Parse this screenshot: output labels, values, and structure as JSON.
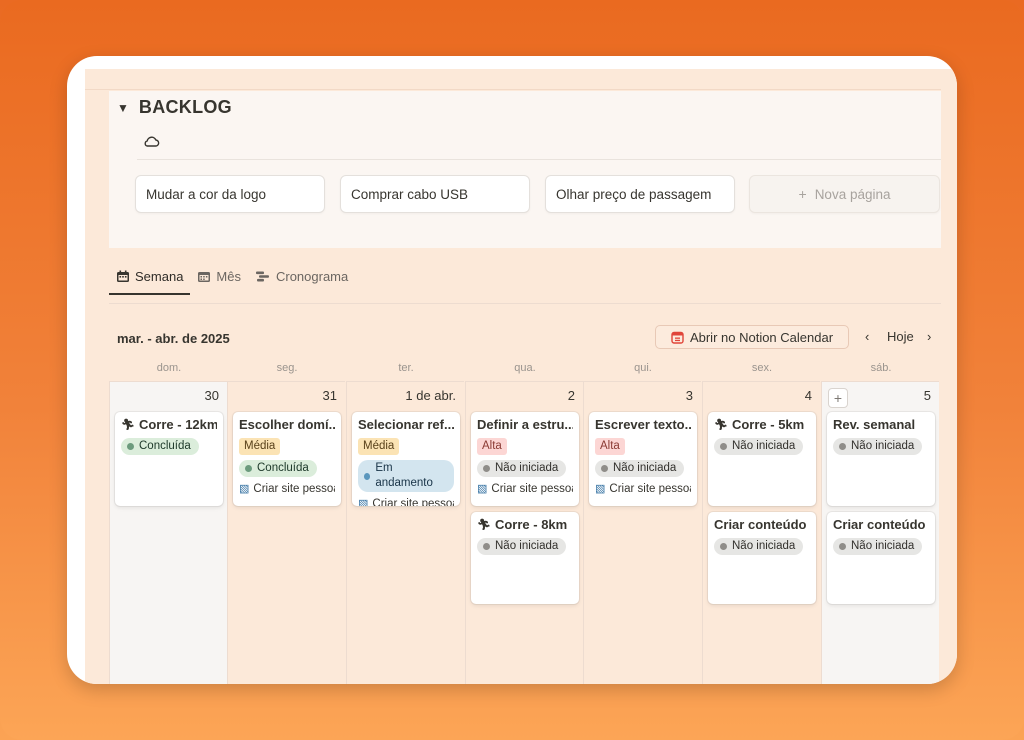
{
  "backlog": {
    "title": "BACKLOG",
    "cards": [
      "Mudar a cor da logo",
      "Comprar cabo USB",
      "Olhar preço de passagem"
    ],
    "new_page": "Nova página"
  },
  "tabs": [
    "Semana",
    "Mês",
    "Cronograma"
  ],
  "calendar": {
    "range": "mar. - abr. de 2025",
    "open_notion": "Abrir no Notion Calendar",
    "today": "Hoje",
    "days": [
      "dom.",
      "seg.",
      "ter.",
      "qua.",
      "qui.",
      "sex.",
      "sáb."
    ],
    "dates": [
      "30",
      "31",
      "1 de abr.",
      "2",
      "3",
      "4",
      "5"
    ]
  },
  "events": {
    "sun": {
      "title": "Corre - 12km",
      "status": "Concluída"
    },
    "mon": {
      "title": "Escolher domí...",
      "priority": "Média",
      "status": "Concluída",
      "relation": "Criar site pessoal"
    },
    "tue": {
      "title": "Selecionar ref...",
      "priority": "Média",
      "status": "Em andamento",
      "relation": "Criar site pessoal"
    },
    "wed1": {
      "title": "Definir a estru...",
      "priority": "Alta",
      "status": "Não iniciada",
      "relation": "Criar site pessoal"
    },
    "wed2": {
      "title": "Corre - 8km",
      "status": "Não iniciada"
    },
    "thu": {
      "title": "Escrever texto...",
      "priority": "Alta",
      "status": "Não iniciada",
      "relation": "Criar site pessoal"
    },
    "fri1": {
      "title": "Corre - 5km",
      "status": "Não iniciada"
    },
    "fri2": {
      "title": "Criar conteúdo",
      "status": "Não iniciada"
    },
    "sat1": {
      "title": "Rev. semanal",
      "status": "Não iniciada"
    },
    "sat2": {
      "title": "Criar conteúdo",
      "status": "Não iniciada"
    }
  },
  "colors": {
    "background": "#ef7a30",
    "page": "#fce9d9",
    "done": "#dbeddb",
    "not_started": "#e6e6e4",
    "in_progress": "#d3e5ef",
    "alta": "#fcd6d4",
    "media": "#fbe3b4"
  }
}
